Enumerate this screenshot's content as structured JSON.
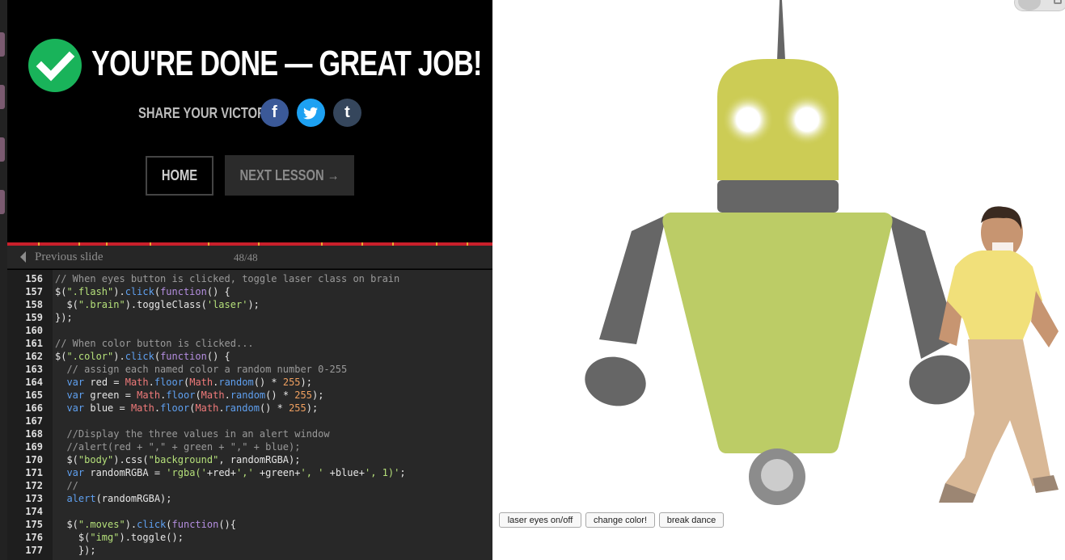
{
  "done_panel": {
    "title": "YOU'RE DONE — GREAT JOB!",
    "share_label": "SHARE YOUR VICTORY:",
    "social": {
      "facebook": "f",
      "twitter": "t",
      "tumblr": "t"
    },
    "home_label": "HOME",
    "next_label": "NEXT LESSON →"
  },
  "slide_nav": {
    "prev_label": "Previous slide",
    "counter": "48/48"
  },
  "code": {
    "lines": [
      {
        "n": "156",
        "html": "<span class=\"cm\">// When eyes button is clicked, toggle laser class on brain</span>"
      },
      {
        "n": "157",
        "html": "$(<span class=\"st\">\".flash\"</span>).<span class=\"kw\">click</span>(<span class=\"fn\">function</span>() {"
      },
      {
        "n": "158",
        "html": "  $(<span class=\"st\">\".brain\"</span>).toggleClass(<span class=\"st\">'laser'</span>);"
      },
      {
        "n": "159",
        "html": "});"
      },
      {
        "n": "160",
        "html": ""
      },
      {
        "n": "161",
        "html": "<span class=\"cm\">// When color button is clicked...</span>"
      },
      {
        "n": "162",
        "html": "$(<span class=\"st\">\".color\"</span>).<span class=\"kw\">click</span>(<span class=\"fn\">function</span>() {"
      },
      {
        "n": "163",
        "html": "  <span class=\"cm\">// assign each named color a random number 0-255</span>"
      },
      {
        "n": "164",
        "html": "  <span class=\"kw\">var</span> red = <span class=\"ob\">Math</span>.<span class=\"kw\">floor</span>(<span class=\"ob\">Math</span>.<span class=\"kw\">random</span>() * <span class=\"nm\">255</span>);"
      },
      {
        "n": "165",
        "html": "  <span class=\"kw\">var</span> green = <span class=\"ob\">Math</span>.<span class=\"kw\">floor</span>(<span class=\"ob\">Math</span>.<span class=\"kw\">random</span>() * <span class=\"nm\">255</span>);"
      },
      {
        "n": "166",
        "html": "  <span class=\"kw\">var</span> blue = <span class=\"ob\">Math</span>.<span class=\"kw\">floor</span>(<span class=\"ob\">Math</span>.<span class=\"kw\">random</span>() * <span class=\"nm\">255</span>);"
      },
      {
        "n": "167",
        "html": ""
      },
      {
        "n": "168",
        "html": "  <span class=\"cm\">//Display the three values in an alert window</span>"
      },
      {
        "n": "169",
        "html": "  <span class=\"cm\">//alert(red + \",\" + green + \",\" + blue);</span>"
      },
      {
        "n": "170",
        "html": "  $(<span class=\"st\">\"body\"</span>).css(<span class=\"st\">\"background\"</span>, randomRGBA);"
      },
      {
        "n": "171",
        "html": "  <span class=\"kw\">var</span> randomRGBA = <span class=\"st\">'rgba('</span>+red+<span class=\"st\">','</span> +green+<span class=\"st\">', '</span> +blue+<span class=\"st\">', 1)'</span>;"
      },
      {
        "n": "172",
        "html": "  <span class=\"cm\">//</span>"
      },
      {
        "n": "173",
        "html": "  <span class=\"kw\">alert</span>(randomRGBA);"
      },
      {
        "n": "174",
        "html": ""
      },
      {
        "n": "175",
        "html": "  $(<span class=\"st\">\".moves\"</span>).<span class=\"kw\">click</span>(<span class=\"fn\">function</span>(){"
      },
      {
        "n": "176",
        "html": "    $(<span class=\"st\">\"img\"</span>).toggle();"
      },
      {
        "n": "177",
        "html": "    });"
      }
    ]
  },
  "demo_buttons": {
    "laser": "laser eyes on/off",
    "color": "change color!",
    "dance": "break dance"
  },
  "colors": {
    "check_green": "#19b35a",
    "progress_red": "#c91f2b",
    "robot_head": "#cccc55",
    "robot_body": "#bccc66",
    "robot_gray": "#666666"
  }
}
